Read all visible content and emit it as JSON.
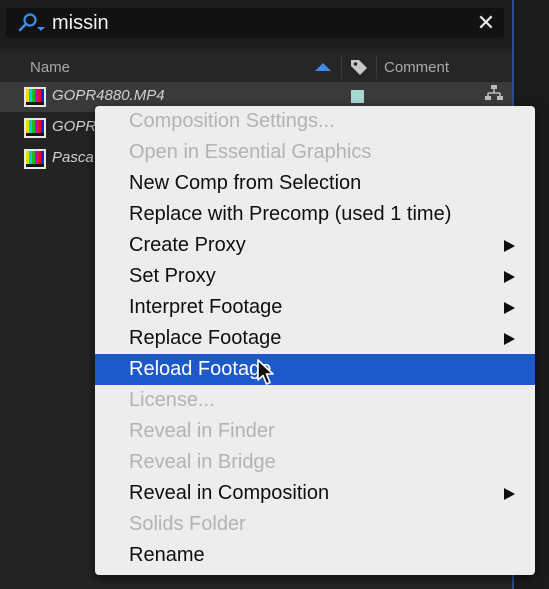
{
  "search": {
    "value": "missin",
    "clear_icon": "close-icon",
    "icon": "search-icon"
  },
  "columns": {
    "name": "Name",
    "comment": "Comment"
  },
  "files": [
    {
      "name": "GOPR4880.MP4"
    },
    {
      "name": "GOPR"
    },
    {
      "name": "Pasca"
    }
  ],
  "context_menu": {
    "items": [
      {
        "label": "Composition Settings...",
        "state": "disabled",
        "submenu": false
      },
      {
        "label": "Open in Essential Graphics",
        "state": "disabled",
        "submenu": false
      },
      {
        "label": "New Comp from Selection",
        "state": "enabled",
        "submenu": false
      },
      {
        "label": "Replace with Precomp (used 1 time)",
        "state": "enabled",
        "submenu": false
      },
      {
        "label": "Create Proxy",
        "state": "enabled",
        "submenu": true
      },
      {
        "label": "Set Proxy",
        "state": "enabled",
        "submenu": true
      },
      {
        "label": "Interpret Footage",
        "state": "enabled",
        "submenu": true
      },
      {
        "label": "Replace Footage",
        "state": "enabled",
        "submenu": true
      },
      {
        "label": "Reload Footage",
        "state": "highlighted",
        "submenu": false
      },
      {
        "label": "License...",
        "state": "disabled",
        "submenu": false
      },
      {
        "label": "Reveal in Finder",
        "state": "disabled",
        "submenu": false
      },
      {
        "label": "Reveal in Bridge",
        "state": "disabled",
        "submenu": false
      },
      {
        "label": "Reveal in Composition",
        "state": "enabled",
        "submenu": true
      },
      {
        "label": "Solids Folder",
        "state": "disabled",
        "submenu": false
      },
      {
        "label": "Rename",
        "state": "enabled",
        "submenu": false
      }
    ]
  },
  "colors": {
    "highlight": "#1d59ca",
    "menu_background": "#ededed",
    "disabled_text": "#b3b3b3",
    "label_swatch": "#a8d8d3",
    "panel_background": "#232323"
  }
}
